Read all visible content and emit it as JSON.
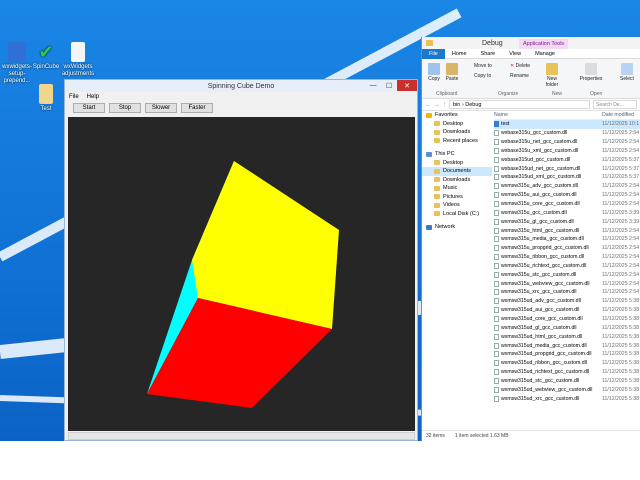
{
  "desktop": {
    "icons": [
      {
        "label": "wxwidgets-setup-prepend..."
      },
      {
        "label": "SpinCube"
      },
      {
        "label": "wxWidgets adjustments"
      },
      {
        "label": "Test"
      }
    ]
  },
  "cube_window": {
    "title": "Spinning Cube Demo",
    "menu": [
      "File",
      "Help"
    ],
    "buttons": [
      "Start",
      "Stop",
      "Slower",
      "Faster"
    ],
    "min": "—",
    "max": "☐",
    "close": "✕",
    "colors": {
      "top": "#ffff00",
      "front": "#ff0000",
      "left": "#00ffff",
      "background": "#262626"
    }
  },
  "explorer": {
    "title": "Debug",
    "context_tab": "Application Tools",
    "tabs": [
      "File",
      "Home",
      "Share",
      "View",
      "Manage"
    ],
    "ribbon": {
      "copy": "Copy",
      "paste": "Paste",
      "move_to": "Move to",
      "copy_to": "Copy to",
      "delete": "Delete",
      "rename": "Rename",
      "new_folder": "New folder",
      "properties": "Properties",
      "select": "Select",
      "groups": [
        "Clipboard",
        "Organize",
        "New",
        "Open"
      ]
    },
    "address": "bin  ›  Debug",
    "search_placeholder": "Search De...",
    "nav": [
      {
        "label": "Favorites"
      },
      {
        "label": "Desktop"
      },
      {
        "label": "Downloads"
      },
      {
        "label": "Recent places"
      },
      {
        "label": "This PC"
      },
      {
        "label": "Desktop"
      },
      {
        "label": "Documents"
      },
      {
        "label": "Downloads"
      },
      {
        "label": "Music"
      },
      {
        "label": "Pictures"
      },
      {
        "label": "Videos"
      },
      {
        "label": "Local Disk (C:)"
      },
      {
        "label": "Network"
      }
    ],
    "columns": {
      "name": "Name",
      "date": "Date modified"
    },
    "files": [
      {
        "name": "test",
        "date": "11/12/2025 10:1"
      },
      {
        "name": "wxbase315u_gcc_custom.dll",
        "date": "11/12/2025 2:54"
      },
      {
        "name": "wxbase315u_net_gcc_custom.dll",
        "date": "11/12/2025 2:54"
      },
      {
        "name": "wxbase315u_xml_gcc_custom.dll",
        "date": "11/12/2025 2:54"
      },
      {
        "name": "wxbase315ud_gcc_custom.dll",
        "date": "11/12/2025 5:37"
      },
      {
        "name": "wxbase315ud_net_gcc_custom.dll",
        "date": "11/12/2025 5:37"
      },
      {
        "name": "wxbase315ud_xml_gcc_custom.dll",
        "date": "11/12/2025 5:37"
      },
      {
        "name": "wxmsw315u_adv_gcc_custom.dll",
        "date": "11/12/2025 2:54"
      },
      {
        "name": "wxmsw315u_aui_gcc_custom.dll",
        "date": "11/12/2025 2:54"
      },
      {
        "name": "wxmsw315u_core_gcc_custom.dll",
        "date": "11/12/2025 2:54"
      },
      {
        "name": "wxmsw315u_gcc_custom.dll",
        "date": "11/12/2025 3:39"
      },
      {
        "name": "wxmsw315u_gl_gcc_custom.dll",
        "date": "11/12/2025 3:39"
      },
      {
        "name": "wxmsw315u_html_gcc_custom.dll",
        "date": "11/12/2025 2:54"
      },
      {
        "name": "wxmsw315u_media_gcc_custom.dll",
        "date": "11/12/2025 2:54"
      },
      {
        "name": "wxmsw315u_propgrid_gcc_custom.dll",
        "date": "11/12/2025 2:54"
      },
      {
        "name": "wxmsw315u_ribbon_gcc_custom.dll",
        "date": "11/12/2025 2:54"
      },
      {
        "name": "wxmsw315u_richtext_gcc_custom.dll",
        "date": "11/12/2025 2:54"
      },
      {
        "name": "wxmsw315u_stc_gcc_custom.dll",
        "date": "11/12/2025 2:54"
      },
      {
        "name": "wxmsw315u_webview_gcc_custom.dll",
        "date": "11/12/2025 2:54"
      },
      {
        "name": "wxmsw315u_xrc_gcc_custom.dll",
        "date": "11/12/2025 2:54"
      },
      {
        "name": "wxmsw315ud_adv_gcc_custom.dll",
        "date": "11/12/2025 5:38"
      },
      {
        "name": "wxmsw315ud_aui_gcc_custom.dll",
        "date": "11/12/2025 5:38"
      },
      {
        "name": "wxmsw315ud_core_gcc_custom.dll",
        "date": "11/12/2025 5:38"
      },
      {
        "name": "wxmsw315ud_gl_gcc_custom.dll",
        "date": "11/12/2025 5:38"
      },
      {
        "name": "wxmsw315ud_html_gcc_custom.dll",
        "date": "11/12/2025 5:38"
      },
      {
        "name": "wxmsw315ud_media_gcc_custom.dll",
        "date": "11/12/2025 5:38"
      },
      {
        "name": "wxmsw315ud_propgrid_gcc_custom.dll",
        "date": "11/12/2025 5:38"
      },
      {
        "name": "wxmsw315ud_ribbon_gcc_custom.dll",
        "date": "11/12/2025 5:38"
      },
      {
        "name": "wxmsw315ud_richtext_gcc_custom.dll",
        "date": "11/12/2025 5:38"
      },
      {
        "name": "wxmsw315ud_stc_gcc_custom.dll",
        "date": "11/12/2025 5:38"
      },
      {
        "name": "wxmsw315ud_webview_gcc_custom.dll",
        "date": "11/12/2025 5:38"
      },
      {
        "name": "wxmsw315ud_xrc_gcc_custom.dll",
        "date": "11/12/2025 5:38"
      }
    ],
    "selected_index": 0,
    "status": {
      "items": "32 items",
      "selected": "1 item selected  1.63 MB"
    }
  }
}
